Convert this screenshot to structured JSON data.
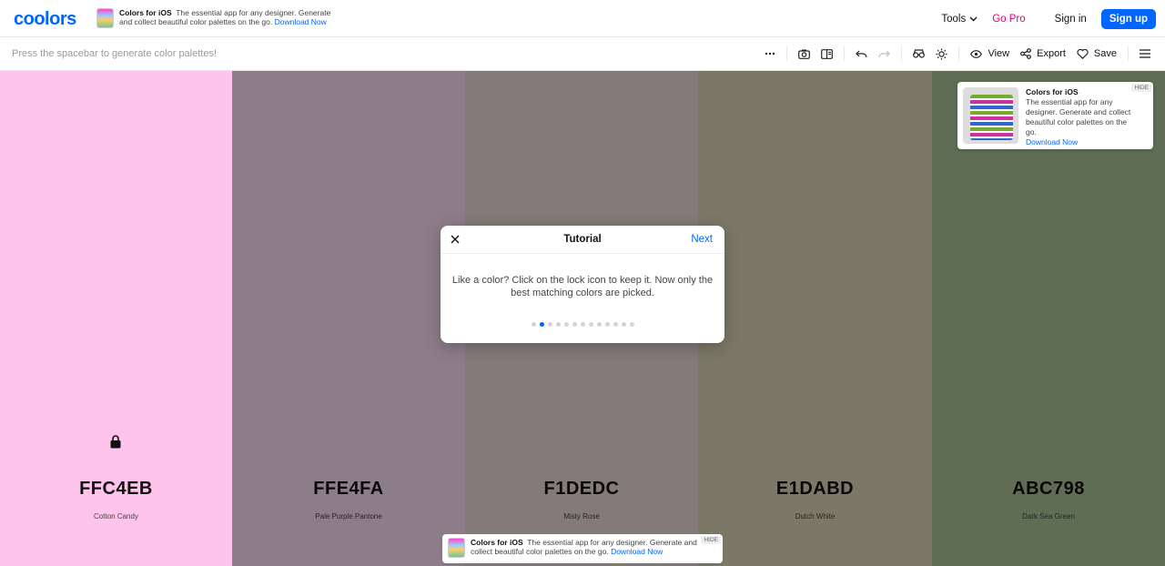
{
  "header": {
    "logo": "coolors",
    "ad": {
      "title": "Colors for iOS",
      "text": "The essential app for any designer. Generate and collect beautiful color palettes on the go.",
      "link": "Download Now"
    },
    "nav": {
      "tools": "Tools",
      "go_pro": "Go Pro",
      "sign_in": "Sign in",
      "sign_up": "Sign up"
    }
  },
  "toolbar": {
    "hint": "Press the spacebar to generate color palettes!",
    "view": "View",
    "export": "Export",
    "save": "Save"
  },
  "palette": [
    {
      "hex": "FFC4EB",
      "name": "Cotton Candy",
      "color": "#FFC4EB"
    },
    {
      "hex": "FFE4FA",
      "name": "Pale Purple Pantone",
      "color": "#FFE4FA"
    },
    {
      "hex": "F1DEDC",
      "name": "Misty Rose",
      "color": "#F1DEDC"
    },
    {
      "hex": "E1DABD",
      "name": "Dutch White",
      "color": "#E1DABD"
    },
    {
      "hex": "ABC798",
      "name": "Dark Sea Green",
      "color": "#ABC798"
    }
  ],
  "side_ad": {
    "hide": "HIDE",
    "title": "Colors for iOS",
    "text": "The essential app for any designer. Generate and collect beautiful color palettes on the go.",
    "link": "Download Now"
  },
  "bottom_ad": {
    "hide": "HIDE",
    "title": "Colors for iOS",
    "text": "The essential app for any designer. Generate and collect beautiful color palettes on the go.",
    "link": "Download Now"
  },
  "modal": {
    "title": "Tutorial",
    "next": "Next",
    "body": "Like a color? Click on the lock icon to keep it. Now only the best matching colors are picked.",
    "step_count": 13,
    "active_step": 2
  }
}
